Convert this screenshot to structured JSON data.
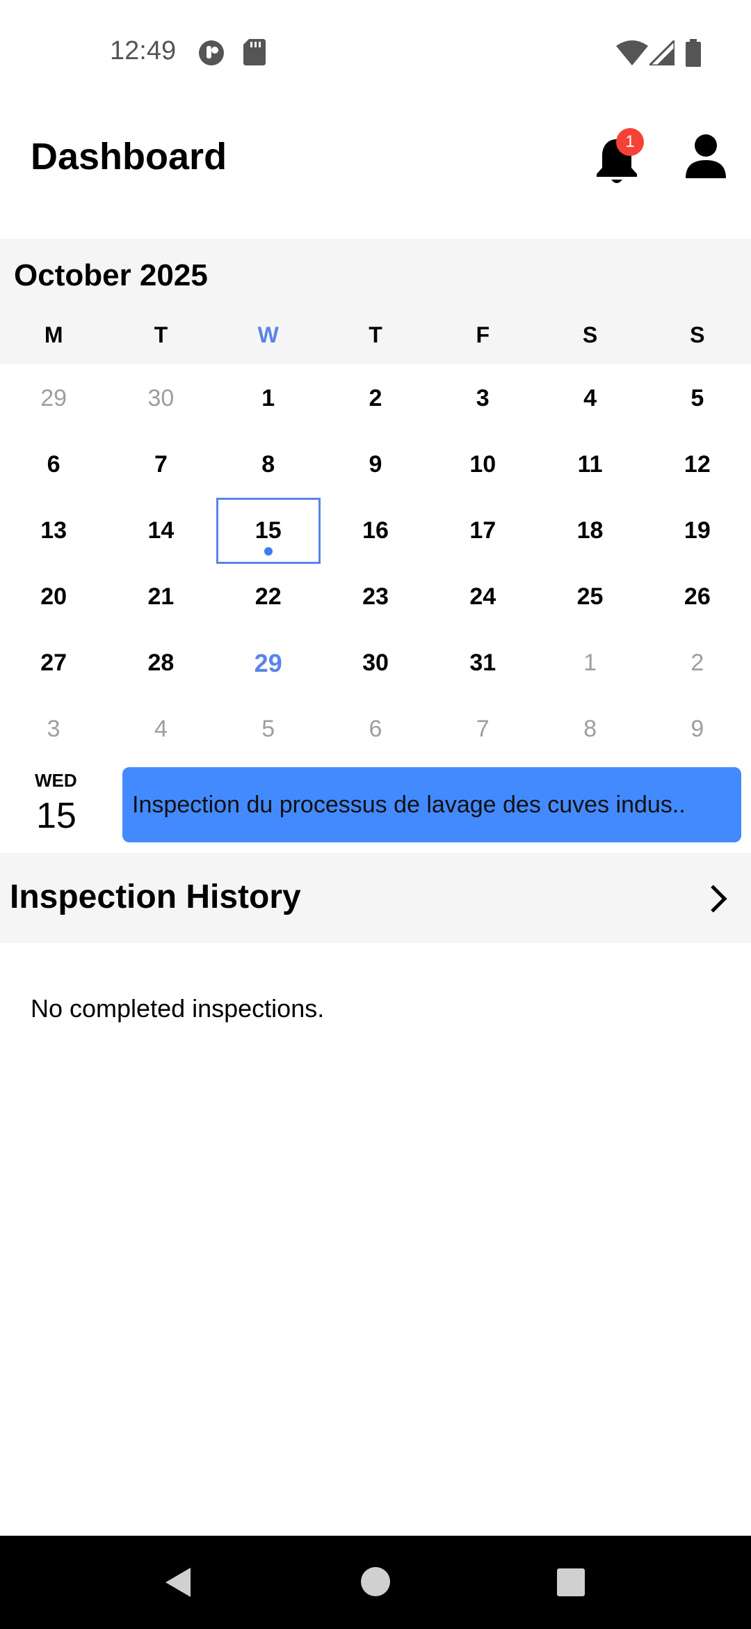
{
  "status_bar": {
    "time": "12:49",
    "icons": [
      "app-icon",
      "sd-card-icon",
      "wifi-icon",
      "signal-icon",
      "battery-icon"
    ]
  },
  "header": {
    "title": "Dashboard",
    "notification_count": "1",
    "icons": [
      "bell-icon",
      "profile-icon"
    ]
  },
  "calendar": {
    "month": "October 2025",
    "weekdays": [
      "M",
      "T",
      "W",
      "T",
      "F",
      "S",
      "S"
    ],
    "today_weekday_index": 2,
    "weeks": [
      [
        {
          "d": "29",
          "m": true
        },
        {
          "d": "30",
          "m": true
        },
        {
          "d": "1"
        },
        {
          "d": "2"
        },
        {
          "d": "3"
        },
        {
          "d": "4"
        },
        {
          "d": "5"
        }
      ],
      [
        {
          "d": "6"
        },
        {
          "d": "7"
        },
        {
          "d": "8"
        },
        {
          "d": "9"
        },
        {
          "d": "10"
        },
        {
          "d": "11"
        },
        {
          "d": "12"
        }
      ],
      [
        {
          "d": "13"
        },
        {
          "d": "14"
        },
        {
          "d": "15",
          "sel": true,
          "dot": true
        },
        {
          "d": "16"
        },
        {
          "d": "17"
        },
        {
          "d": "18"
        },
        {
          "d": "19"
        }
      ],
      [
        {
          "d": "20"
        },
        {
          "d": "21"
        },
        {
          "d": "22"
        },
        {
          "d": "23"
        },
        {
          "d": "24"
        },
        {
          "d": "25"
        },
        {
          "d": "26"
        }
      ],
      [
        {
          "d": "27"
        },
        {
          "d": "28"
        },
        {
          "d": "29",
          "today": true
        },
        {
          "d": "30"
        },
        {
          "d": "31"
        },
        {
          "d": "1",
          "m": true
        },
        {
          "d": "2",
          "m": true
        }
      ],
      [
        {
          "d": "3",
          "m": true
        },
        {
          "d": "4",
          "m": true
        },
        {
          "d": "5",
          "m": true
        },
        {
          "d": "6",
          "m": true
        },
        {
          "d": "7",
          "m": true
        },
        {
          "d": "8",
          "m": true
        },
        {
          "d": "9",
          "m": true
        }
      ]
    ]
  },
  "event": {
    "weekday": "WED",
    "date": "15",
    "title": "Inspection du processus de lavage des cuves indus.."
  },
  "history": {
    "title": "Inspection History",
    "empty_text": "No completed inspections."
  },
  "colors": {
    "accent": "#5b84e8",
    "event_card": "#448aff",
    "badge": "#f44336",
    "section_bg": "#f5f5f5"
  }
}
